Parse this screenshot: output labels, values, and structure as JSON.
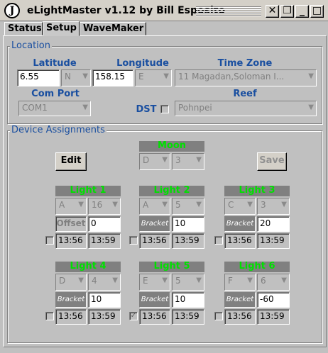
{
  "window": {
    "title": "eLightMaster v1.12 by Bill Esposito",
    "icon_letter": "J"
  },
  "window_buttons": {
    "close": "✕",
    "restore": "❐",
    "minimize": "_",
    "maximize": "□"
  },
  "tabs": [
    {
      "label": "Status"
    },
    {
      "label": "Setup"
    },
    {
      "label": "WaveMaker"
    }
  ],
  "location": {
    "title": "Location",
    "latitude_label": "Latitude",
    "latitude": "6.55",
    "lat_dir": "N",
    "longitude_label": "Longitude",
    "longitude": "158.15",
    "lon_dir": "E",
    "timezone_label": "Time Zone",
    "timezone": "11 Magadan,Soloman I...",
    "comport_label": "Com Port",
    "comport": "COM1",
    "dst_label": "DST",
    "reef_label": "Reef",
    "reef": "Pohnpei"
  },
  "devices": {
    "title": "Device Assignments",
    "edit_label": "Edit",
    "save_label": "Save",
    "moon": {
      "name": "Moon",
      "house": "D",
      "unit": "3"
    },
    "lights": [
      {
        "name": "Light 1",
        "house": "A",
        "unit": "16",
        "mode": "Offset",
        "value": "0",
        "on": "13:56",
        "off": "13:59",
        "checked": false
      },
      {
        "name": "Light 2",
        "house": "A",
        "unit": "5",
        "mode": "Bracket",
        "value": "10",
        "on": "13:56",
        "off": "13:59",
        "checked": false
      },
      {
        "name": "Light 3",
        "house": "C",
        "unit": "3",
        "mode": "Bracket",
        "value": "20",
        "on": "13:56",
        "off": "13:59",
        "checked": false
      },
      {
        "name": "Light 4",
        "house": "D",
        "unit": "4",
        "mode": "Bracket",
        "value": "10",
        "on": "13:56",
        "off": "13:59",
        "checked": false
      },
      {
        "name": "Light 5",
        "house": "E",
        "unit": "5",
        "mode": "Bracket",
        "value": "10",
        "on": "13:56",
        "off": "13:59",
        "checked": true
      },
      {
        "name": "Light 6",
        "house": "F",
        "unit": "6",
        "mode": "Bracket",
        "value": "-60",
        "on": "13:56",
        "off": "13:59",
        "checked": false
      }
    ]
  },
  "colors": {
    "label_blue": "#1a4fa0",
    "device_green": "#00e000",
    "header_gray": "#808080"
  }
}
